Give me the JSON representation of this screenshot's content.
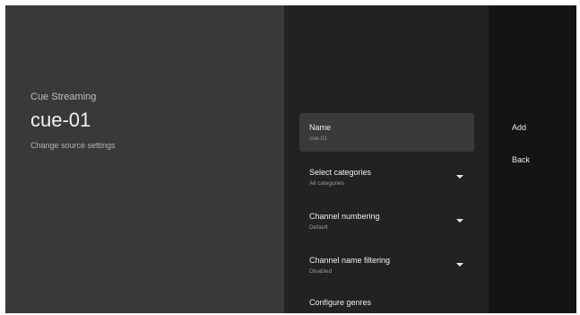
{
  "left": {
    "subtitle": "Cue Streaming",
    "title": "cue-01",
    "description": "Change source settings"
  },
  "settings": [
    {
      "label": "Name",
      "value": "cue-01",
      "dropdown": false,
      "selected": true
    },
    {
      "label": "Select categories",
      "value": "All categories",
      "dropdown": true,
      "selected": false
    },
    {
      "label": "Channel numbering",
      "value": "Default",
      "dropdown": true,
      "selected": false
    },
    {
      "label": "Channel name filtering",
      "value": "Disabled",
      "dropdown": true,
      "selected": false
    },
    {
      "label": "Configure genres",
      "value": "",
      "dropdown": false,
      "selected": false
    }
  ],
  "actions": {
    "add": "Add",
    "back": "Back"
  },
  "icons": {
    "dropdown": "chevron-down-icon"
  },
  "colors": {
    "left_pane": "#393939",
    "middle_pane": "#222222",
    "right_pane": "#141414",
    "selected_item": "#3a3a3a"
  }
}
